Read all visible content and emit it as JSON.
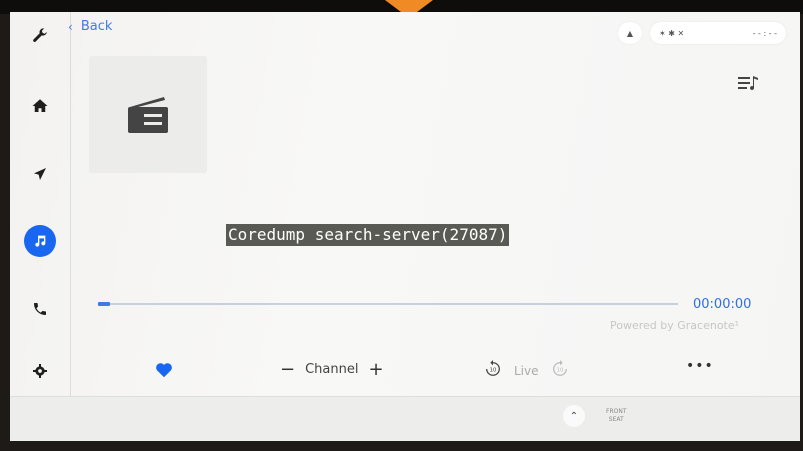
{
  "nav": {
    "back_label": "Back"
  },
  "status": {
    "indicators": [
      "▲",
      "✶ ✱ ✕",
      "- - : - -"
    ]
  },
  "now_playing": {
    "title": "Coredump search-server(27087)",
    "elapsed": "00:00:00",
    "progress_fraction": 0.02,
    "powered_by": "Powered by Gracenote¹"
  },
  "controls": {
    "channel_label": "Channel",
    "minus": "−",
    "plus": "+",
    "live_label": "Live",
    "skip_back": "10",
    "skip_fwd": "10",
    "more": "•••"
  },
  "bottom_bar": {
    "front_label": "FRONT",
    "front_sub": "SEAT"
  },
  "colors": {
    "accent": "#1967f0",
    "link": "#3f7be0",
    "highlight_bg": "#5a5a55",
    "bezel_tab": "#f08a24"
  },
  "icons": {
    "sidebar": [
      "wrench-icon",
      "home-icon",
      "navigation-arrow-icon",
      "music-note-icon",
      "phone-icon",
      "gear-icon"
    ],
    "album_art": "radio-icon",
    "queue": "queue-list-icon"
  }
}
